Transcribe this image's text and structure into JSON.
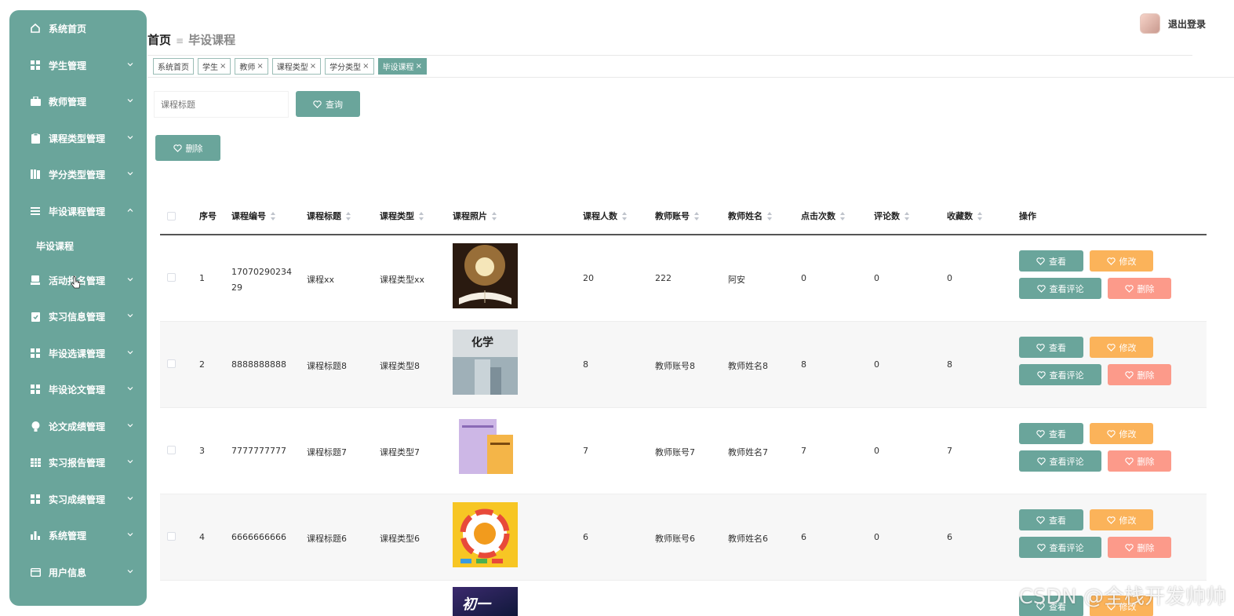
{
  "sidebar": {
    "items": [
      {
        "label": "系统首页",
        "icon": "home-icon"
      },
      {
        "label": "学生管理",
        "icon": "grid-icon"
      },
      {
        "label": "教师管理",
        "icon": "briefcase-icon"
      },
      {
        "label": "课程类型管理",
        "icon": "clipboard-icon"
      },
      {
        "label": "学分类型管理",
        "icon": "book-icon"
      },
      {
        "label": "毕设课程管理",
        "icon": "list-icon"
      },
      {
        "label": "活动报名管理",
        "icon": "printer-icon"
      },
      {
        "label": "实习信息管理",
        "icon": "clipboard-check-icon"
      },
      {
        "label": "毕设选课管理",
        "icon": "grid-icon"
      },
      {
        "label": "毕设论文管理",
        "icon": "grid-icon"
      },
      {
        "label": "论文成绩管理",
        "icon": "bulb-icon"
      },
      {
        "label": "实习报告管理",
        "icon": "table-icon"
      },
      {
        "label": "实习成绩管理",
        "icon": "grid-icon"
      },
      {
        "label": "系统管理",
        "icon": "bar-chart-icon"
      },
      {
        "label": "用户信息",
        "icon": "card-icon"
      }
    ],
    "sub_item": "毕设课程"
  },
  "header": {
    "breadcrumb_home": "首页",
    "breadcrumb_sep": "≡",
    "breadcrumb_current": "毕设课程",
    "logout": "退出登录"
  },
  "tags": [
    {
      "label": "系统首页",
      "closable": false,
      "active": false
    },
    {
      "label": "学生",
      "closable": true,
      "active": false
    },
    {
      "label": "教师",
      "closable": true,
      "active": false
    },
    {
      "label": "课程类型",
      "closable": true,
      "active": false
    },
    {
      "label": "学分类型",
      "closable": true,
      "active": false
    },
    {
      "label": "毕设课程",
      "closable": true,
      "active": true
    }
  ],
  "search": {
    "placeholder": "课程标题",
    "query_label": "查询",
    "delete_label": "删除"
  },
  "table": {
    "columns": [
      "序号",
      "课程编号",
      "课程标题",
      "课程类型",
      "课程照片",
      "课程人数",
      "教师账号",
      "教师姓名",
      "点击次数",
      "评论数",
      "收藏数",
      "操作"
    ],
    "rows": [
      {
        "no": "1",
        "code": "1707029023429",
        "title": "课程xx",
        "type": "课程类型xx",
        "people": "20",
        "account": "222",
        "teacher": "阿安",
        "clicks": "0",
        "comments": "0",
        "favorites": "0"
      },
      {
        "no": "2",
        "code": "8888888888",
        "title": "课程标题8",
        "type": "课程类型8",
        "people": "8",
        "account": "教师账号8",
        "teacher": "教师姓名8",
        "clicks": "8",
        "comments": "0",
        "favorites": "8"
      },
      {
        "no": "3",
        "code": "7777777777",
        "title": "课程标题7",
        "type": "课程类型7",
        "people": "7",
        "account": "教师账号7",
        "teacher": "教师姓名7",
        "clicks": "7",
        "comments": "0",
        "favorites": "7"
      },
      {
        "no": "4",
        "code": "6666666666",
        "title": "课程标题6",
        "type": "课程类型6",
        "people": "6",
        "account": "教师账号6",
        "teacher": "教师姓名6",
        "clicks": "6",
        "comments": "0",
        "favorites": "6"
      }
    ],
    "actions": {
      "view": "查看",
      "edit": "修改",
      "view_comments": "查看评论",
      "delete": "删除"
    },
    "thumb_texts": {
      "row2": "化学",
      "row5": "初一"
    }
  },
  "watermark": "CSDN @全栈开发帅帅",
  "colors": {
    "primary": "#6aa59b",
    "orange": "#fbb35a",
    "red": "#fc9a8a"
  }
}
